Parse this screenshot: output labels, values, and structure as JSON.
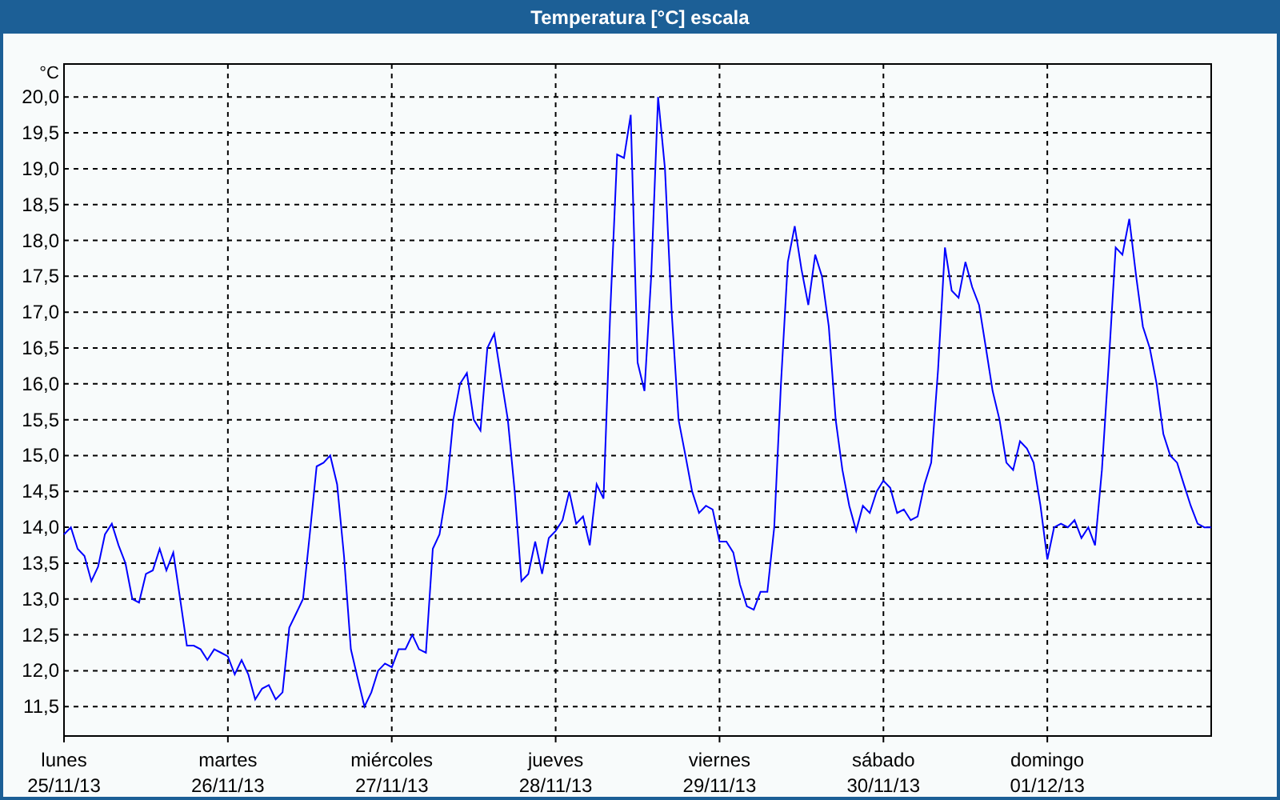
{
  "window": {
    "title": "Temperatura [°C] escala"
  },
  "chart": {
    "dates": [
      "25/11/13",
      "26/11/13",
      "27/11/13",
      "28/11/13",
      "29/11/13",
      "30/11/13",
      "01/12/13"
    ],
    "chart_data": {
      "type": "line",
      "grid": true,
      "ylabel": "°C",
      "ylim": [
        11.09,
        20.46
      ],
      "yticks": [
        {
          "value": 11.5,
          "label": "11,5"
        },
        {
          "value": 12,
          "label": "12,0"
        },
        {
          "value": 12.5,
          "label": "12,5"
        },
        {
          "value": 13,
          "label": "13,0"
        },
        {
          "value": 13.5,
          "label": "13,5"
        },
        {
          "value": 14,
          "label": "14,0"
        },
        {
          "value": 14.5,
          "label": "14,5"
        },
        {
          "value": 15,
          "label": "15,0"
        },
        {
          "value": 15.5,
          "label": "15,5"
        },
        {
          "value": 16,
          "label": "16,0"
        },
        {
          "value": 16.5,
          "label": "16,5"
        },
        {
          "value": 17,
          "label": "17,0"
        },
        {
          "value": 17.5,
          "label": "17,5"
        },
        {
          "value": 18,
          "label": "18,0"
        },
        {
          "value": 18.5,
          "label": "18,5"
        },
        {
          "value": 19,
          "label": "19,0"
        },
        {
          "value": 19.5,
          "label": "19,5"
        },
        {
          "value": 20,
          "label": "20,0"
        }
      ],
      "categories": [
        "lunes",
        null,
        null,
        null,
        null,
        null,
        null,
        null,
        null,
        null,
        null,
        null,
        null,
        null,
        null,
        null,
        null,
        null,
        null,
        null,
        null,
        null,
        null,
        null,
        "martes",
        null,
        null,
        null,
        null,
        null,
        null,
        null,
        null,
        null,
        null,
        null,
        null,
        null,
        null,
        null,
        null,
        null,
        null,
        null,
        null,
        null,
        null,
        null,
        "miércoles",
        null,
        null,
        null,
        null,
        null,
        null,
        null,
        null,
        null,
        null,
        null,
        null,
        null,
        null,
        null,
        null,
        null,
        null,
        null,
        null,
        null,
        null,
        null,
        "jueves",
        null,
        null,
        null,
        null,
        null,
        null,
        null,
        null,
        null,
        null,
        null,
        null,
        null,
        null,
        null,
        null,
        null,
        null,
        null,
        null,
        null,
        null,
        null,
        "viernes",
        null,
        null,
        null,
        null,
        null,
        null,
        null,
        null,
        null,
        null,
        null,
        null,
        null,
        null,
        null,
        null,
        null,
        null,
        null,
        null,
        null,
        null,
        null,
        "sábado",
        null,
        null,
        null,
        null,
        null,
        null,
        null,
        null,
        null,
        null,
        null,
        null,
        null,
        null,
        null,
        null,
        null,
        null,
        null,
        null,
        null,
        null,
        null,
        "domingo",
        null,
        null,
        null,
        null,
        null,
        null,
        null,
        null,
        null,
        null,
        null,
        null,
        null,
        null,
        null,
        null,
        null,
        null,
        null,
        null,
        null,
        null,
        null,
        null
      ],
      "series": [
        {
          "color": "#0000ff",
          "values": [
            13.9,
            14.0,
            13.7,
            13.6,
            13.25,
            13.45,
            13.9,
            14.05,
            13.75,
            13.5,
            13.0,
            12.95,
            13.35,
            13.4,
            13.7,
            13.4,
            13.65,
            13.0,
            12.35,
            12.35,
            12.3,
            12.15,
            12.3,
            12.25,
            12.2,
            11.95,
            12.15,
            11.95,
            11.6,
            11.75,
            11.8,
            11.6,
            11.7,
            12.6,
            12.8,
            13.0,
            13.9,
            14.85,
            14.9,
            15.0,
            14.6,
            13.6,
            12.3,
            11.9,
            11.5,
            11.7,
            12.0,
            12.1,
            12.05,
            12.3,
            12.3,
            12.5,
            12.3,
            12.25,
            13.7,
            13.9,
            14.5,
            15.5,
            16.0,
            16.15,
            15.5,
            15.35,
            16.5,
            16.7,
            16.1,
            15.5,
            14.5,
            13.25,
            13.35,
            13.8,
            13.35,
            13.85,
            13.95,
            14.1,
            14.5,
            14.05,
            14.15,
            13.75,
            14.6,
            14.4,
            17.0,
            19.2,
            19.15,
            19.75,
            16.3,
            15.9,
            17.5,
            20.0,
            19.0,
            17.0,
            15.5,
            15.0,
            14.5,
            14.2,
            14.3,
            14.25,
            13.8,
            13.8,
            13.65,
            13.2,
            12.9,
            12.85,
            13.1,
            13.1,
            14.0,
            16.0,
            17.7,
            18.2,
            17.6,
            17.1,
            17.8,
            17.5,
            16.8,
            15.5,
            14.8,
            14.3,
            13.95,
            14.3,
            14.2,
            14.5,
            14.65,
            14.55,
            14.2,
            14.25,
            14.1,
            14.15,
            14.6,
            14.9,
            16.2,
            17.9,
            17.3,
            17.2,
            17.7,
            17.35,
            17.1,
            16.5,
            15.9,
            15.5,
            14.9,
            14.8,
            15.2,
            15.1,
            14.9,
            14.3,
            13.55,
            14.0,
            14.05,
            14.0,
            14.1,
            13.85,
            14.0,
            13.75,
            14.8,
            16.3,
            17.9,
            17.8,
            18.3,
            17.5,
            16.8,
            16.5,
            16.0,
            15.3,
            15.0,
            14.9,
            14.6,
            14.3,
            14.05,
            14.0,
            14.0
          ]
        }
      ]
    }
  }
}
